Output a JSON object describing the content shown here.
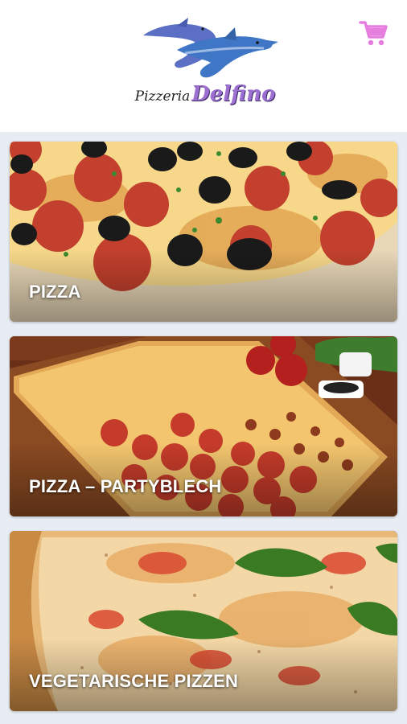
{
  "header": {
    "logo_word1": "Pizzeria",
    "logo_word2": "Delfino",
    "cart_icon": "shopping-cart-icon",
    "accent_color": "#e67ee0"
  },
  "categories": [
    {
      "label": "PIZZA",
      "image": "pepperoni-olive-pizza-photo"
    },
    {
      "label": "PIZZA – PARTYBLECH",
      "image": "party-tray-pizza-photo"
    },
    {
      "label": "VEGETARISCHE PIZZEN",
      "image": "margherita-basil-pizza-photo"
    }
  ]
}
